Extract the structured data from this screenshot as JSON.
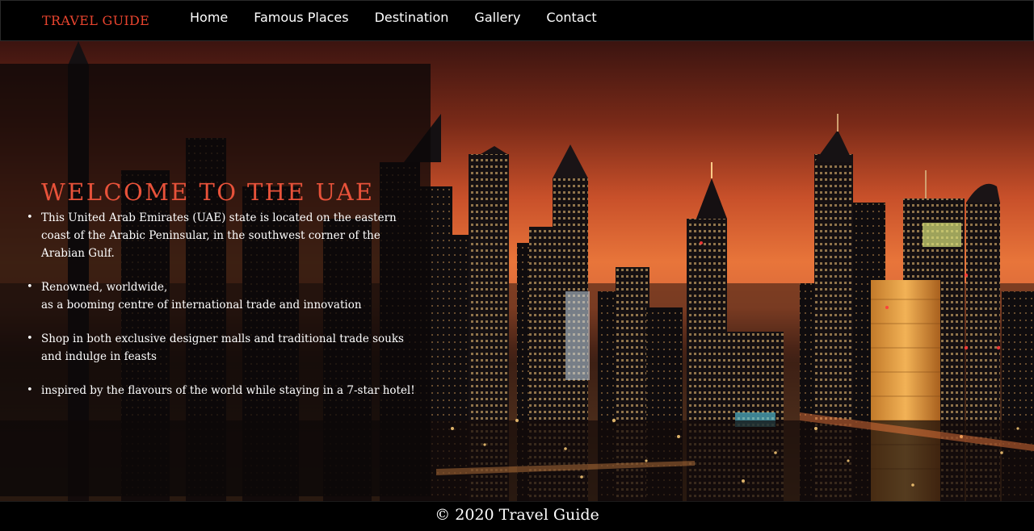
{
  "brand": "TRAVEL GUIDE",
  "nav": {
    "items": [
      {
        "label": "Home"
      },
      {
        "label": "Famous Places"
      },
      {
        "label": "Destination"
      },
      {
        "label": "Gallery"
      },
      {
        "label": "Contact"
      }
    ]
  },
  "hero": {
    "title": "WELCOME TO THE UAE",
    "bullets": [
      {
        "lines": [
          "This United Arab Emirates (UAE) state is located on the eastern",
          "coast of the Arabic Peninsular, in the southwest corner of the",
          "Arabian Gulf."
        ]
      },
      {
        "lines": [
          "Renowned, worldwide,",
          "as a booming centre of international trade and innovation"
        ]
      },
      {
        "lines": [
          "Shop in both exclusive designer malls and traditional trade souks",
          "and indulge in feasts"
        ]
      },
      {
        "lines": [
          "inspired by the flavours of the world while staying in a 7-star hotel!"
        ]
      }
    ],
    "bullet_glyph": "•",
    "background_image": "dubai-skyline-at-dusk"
  },
  "footer": {
    "text": "© 2020 Travel Guide"
  },
  "colors": {
    "accent": "#e8442e",
    "title": "#e8523a",
    "bar_background": "#000000",
    "panel_background": "#0c0808"
  }
}
